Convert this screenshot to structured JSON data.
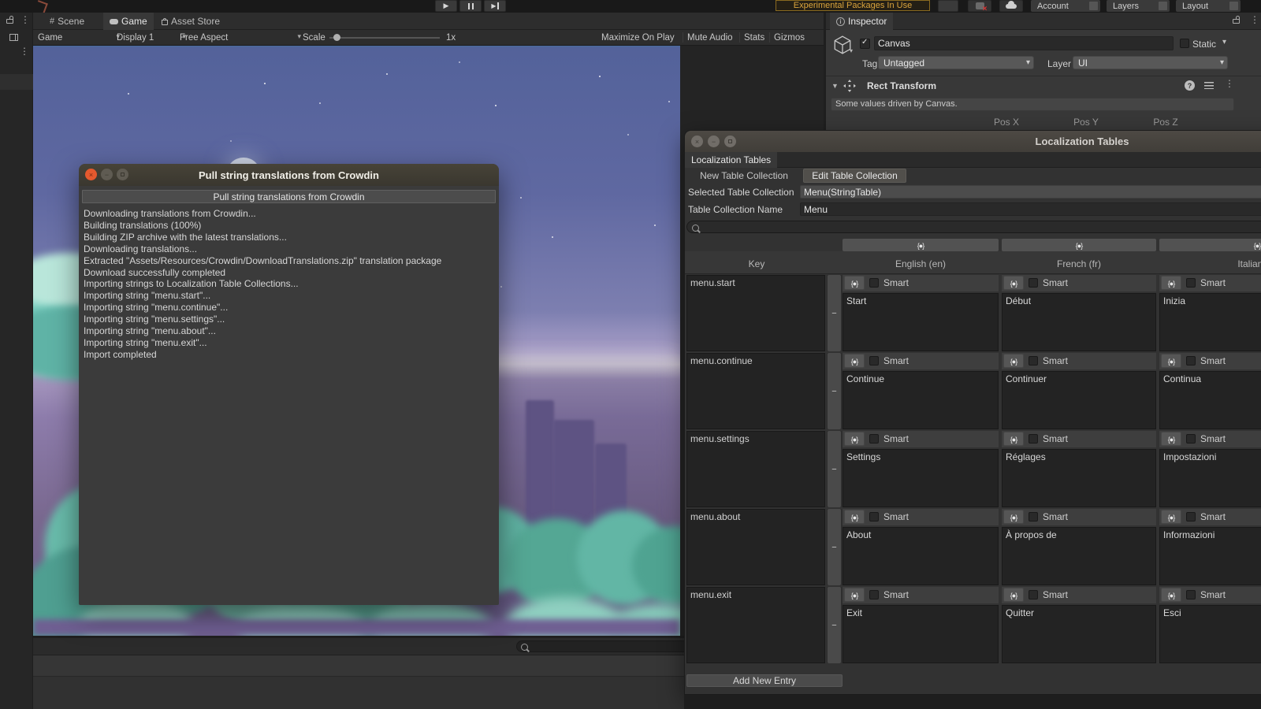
{
  "colors": {
    "warning_text": "#d9a33c",
    "close_button": "#e4592e",
    "focus_accent": "#4a6b9c"
  },
  "top_toolbar": {
    "experimental_warning": "Experimental Packages In Use",
    "account": "Account",
    "layers": "Layers",
    "layout": "Layout"
  },
  "game_panel": {
    "tabs": [
      {
        "label": "Scene"
      },
      {
        "label": "Game"
      },
      {
        "label": "Asset Store"
      }
    ],
    "toolbar": {
      "game_dropdown": "Game",
      "display_dropdown": "Display 1",
      "aspect_dropdown": "Free Aspect",
      "scale_label": "Scale",
      "scale_value": "1x",
      "maximize_on_play": "Maximize On Play",
      "mute_audio": "Mute Audio",
      "stats": "Stats",
      "gizmos": "Gizmos"
    }
  },
  "inspector": {
    "tab_label": "Inspector",
    "object_name": "Canvas",
    "static_label": "Static",
    "tag_label": "Tag",
    "tag_value": "Untagged",
    "layer_label": "Layer",
    "layer_value": "UI",
    "rect_transform": {
      "title": "Rect Transform",
      "info": "Some values driven by Canvas.",
      "pos_labels": [
        "Pos X",
        "Pos Y",
        "Pos Z"
      ]
    }
  },
  "crowdin_dialog": {
    "title": "Pull string translations from Crowdin",
    "header_button": "Pull string translations from Crowdin",
    "log_lines": [
      "Downloading translations from Crowdin...",
      "Building translations (100%)",
      "Building ZIP archive with the latest translations...",
      "Downloading translations...",
      "Extracted \"Assets/Resources/Crowdin/DownloadTranslations.zip\" translation package",
      "Download successfully completed",
      "Importing strings to Localization Table Collections...",
      "Importing string \"menu.start\"...",
      "Importing string \"menu.continue\"...",
      "Importing string \"menu.settings\"...",
      "Importing string \"menu.about\"...",
      "Importing string \"menu.exit\"...",
      "Import completed"
    ]
  },
  "localization_window": {
    "title": "Localization Tables",
    "tab_label": "Localization Tables",
    "new_table_button": "New Table Collection",
    "edit_table_button": "Edit Table Collection",
    "selected_table_label": "Selected Table Collection",
    "selected_table_value": "Menu(StringTable)",
    "collection_name_label": "Table Collection Name",
    "collection_name_value": "Menu",
    "smart_label": "Smart",
    "add_entry_button": "Add New Entry",
    "table": {
      "key_header": "Key",
      "language_columns": [
        "English (en)",
        "French (fr)",
        "Italian (it)"
      ],
      "rows": [
        {
          "key": "menu.start",
          "values": [
            "Start",
            "Début",
            "Inizia"
          ]
        },
        {
          "key": "menu.continue",
          "values": [
            "Continue",
            "Continuer",
            "Continua"
          ]
        },
        {
          "key": "menu.settings",
          "values": [
            "Settings",
            "Réglages",
            "Impostazioni"
          ]
        },
        {
          "key": "menu.about",
          "values": [
            "About",
            "À propos de",
            "Informazioni"
          ]
        },
        {
          "key": "menu.exit",
          "values": [
            "Exit",
            "Quitter",
            "Esci"
          ]
        }
      ]
    }
  }
}
